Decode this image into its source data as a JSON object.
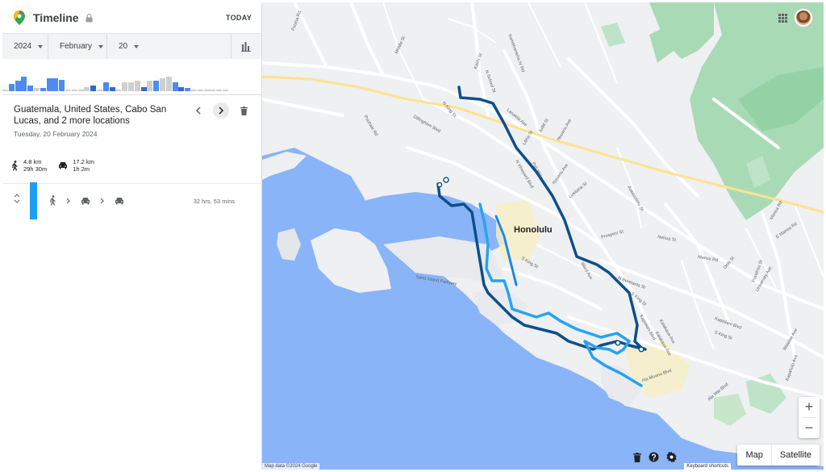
{
  "header": {
    "title": "Timeline",
    "today_label": "TODAY"
  },
  "date_selector": {
    "year": "2024",
    "month": "February",
    "day": "20"
  },
  "histogram": {
    "bars": [
      {
        "v": 0.05,
        "c": "grey"
      },
      {
        "v": 0.25,
        "c": "blue"
      },
      {
        "v": 0.35,
        "c": "blue"
      },
      {
        "v": 0.5,
        "c": "blue"
      },
      {
        "v": 0.2,
        "c": "blue"
      },
      {
        "v": 0.1,
        "c": "grey"
      },
      {
        "v": 0.1,
        "c": "blue"
      },
      {
        "v": 0.45,
        "c": "blue"
      },
      {
        "v": 0.45,
        "c": "blue"
      },
      {
        "v": 0.4,
        "c": "blue"
      },
      {
        "v": 0.05,
        "c": "grey"
      },
      {
        "v": 0.05,
        "c": "grey"
      },
      {
        "v": 0.05,
        "c": "grey"
      },
      {
        "v": 0.15,
        "c": "grey"
      },
      {
        "v": 0.2,
        "c": "dark"
      },
      {
        "v": 0.05,
        "c": "grey"
      },
      {
        "v": 0.3,
        "c": "blue"
      },
      {
        "v": 0.15,
        "c": "dark"
      },
      {
        "v": 0.05,
        "c": "grey"
      },
      {
        "v": 0.3,
        "c": "grey"
      },
      {
        "v": 0.3,
        "c": "grey"
      },
      {
        "v": 0.35,
        "c": "grey"
      },
      {
        "v": 0.15,
        "c": "dark"
      },
      {
        "v": 0.35,
        "c": "grey"
      },
      {
        "v": 0.35,
        "c": "blue"
      },
      {
        "v": 0.45,
        "c": "grey"
      },
      {
        "v": 0.5,
        "c": "grey"
      },
      {
        "v": 0.3,
        "c": "blue"
      },
      {
        "v": 0.15,
        "c": "dark"
      },
      {
        "v": 0.1,
        "c": "blue"
      },
      {
        "v": 0.05,
        "c": "grey"
      },
      {
        "v": 0.05,
        "c": "grey"
      },
      {
        "v": 0.05,
        "c": "grey"
      },
      {
        "v": 0.05,
        "c": "grey"
      },
      {
        "v": 0.05,
        "c": "grey"
      },
      {
        "v": 0.05,
        "c": "grey"
      }
    ]
  },
  "summary": {
    "places": "Guatemala, United States, Cabo San Lucas, and 2 more locations",
    "date": "Tuesday, 20 February 2024",
    "walking": {
      "distance": "4.8 km",
      "duration": "29h 30m"
    },
    "driving": {
      "distance": "17.2 km",
      "duration": "1h 2m"
    }
  },
  "segment": {
    "duration": "32 hrs, 53 mins",
    "color": "#1e9ef3"
  },
  "map": {
    "city_label": "Honolulu",
    "street_labels": [
      "Puuloa Rd",
      "Middle St",
      "N King St",
      "Kalihi St",
      "N School St",
      "Kamehameha IV Rd",
      "Dillingham Blvd",
      "Puuhale Rd",
      "Lanakila Ave",
      "Liliha St",
      "Judd St",
      "Nuuanu Ave",
      "N Vineyard Blvd",
      "Pali Hwy",
      "Nuuanu Ave",
      "Lusitana St",
      "Auwaiolimu St",
      "Prospect St",
      "Nehoa St",
      "Manoa Rd",
      "E Manoa Rd",
      "Dole St",
      "Mance Rd",
      "S King St",
      "Punahou St",
      "Sand Island Parkway",
      "Ward Ave",
      "S King St",
      "Kapiolani Blvd",
      "Ala Moana Blvd",
      "Kalakaua Ave",
      "Ala Wai Blvd",
      "Kapahulu Ave",
      "University Ave",
      "N Beretania St",
      "Kapiolani Blvd",
      "S King St",
      "Kalakaua Ave",
      "Waialae Ave"
    ],
    "route_dark_color": "#0d4f8b",
    "route_light_color": "#29a3ee"
  },
  "map_controls": {
    "zoom_in": "+",
    "zoom_out": "−",
    "map_label": "Map",
    "satellite_label": "Satellite",
    "attribution": "Map data ©2024 Google",
    "keyboard": "Keyboard shortcuts"
  }
}
